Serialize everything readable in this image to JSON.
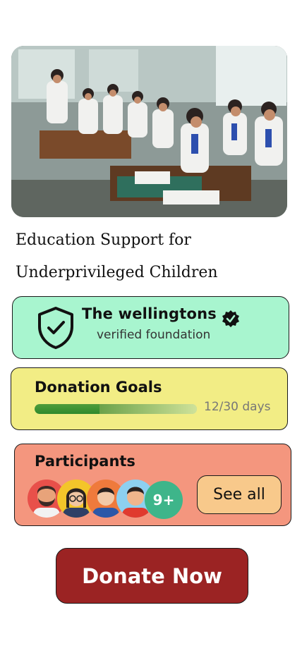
{
  "campaign": {
    "title_line1": "Education Support for",
    "title_line2": "Underprivileged Children"
  },
  "foundation": {
    "name": "The wellingtons",
    "subtitle": "verified foundation"
  },
  "goals": {
    "title": "Donation Goals",
    "progress_text": "12/30 days",
    "progress_fraction": 0.4
  },
  "participants": {
    "title": "Participants",
    "more_label": "9+",
    "see_all_label": "See all"
  },
  "donate_label": "Donate Now",
  "colors": {
    "foundation_bg": "#a8f5cf",
    "goals_bg": "#f2ed85",
    "participants_bg": "#f4967e",
    "donate_bg": "#9b2323"
  }
}
